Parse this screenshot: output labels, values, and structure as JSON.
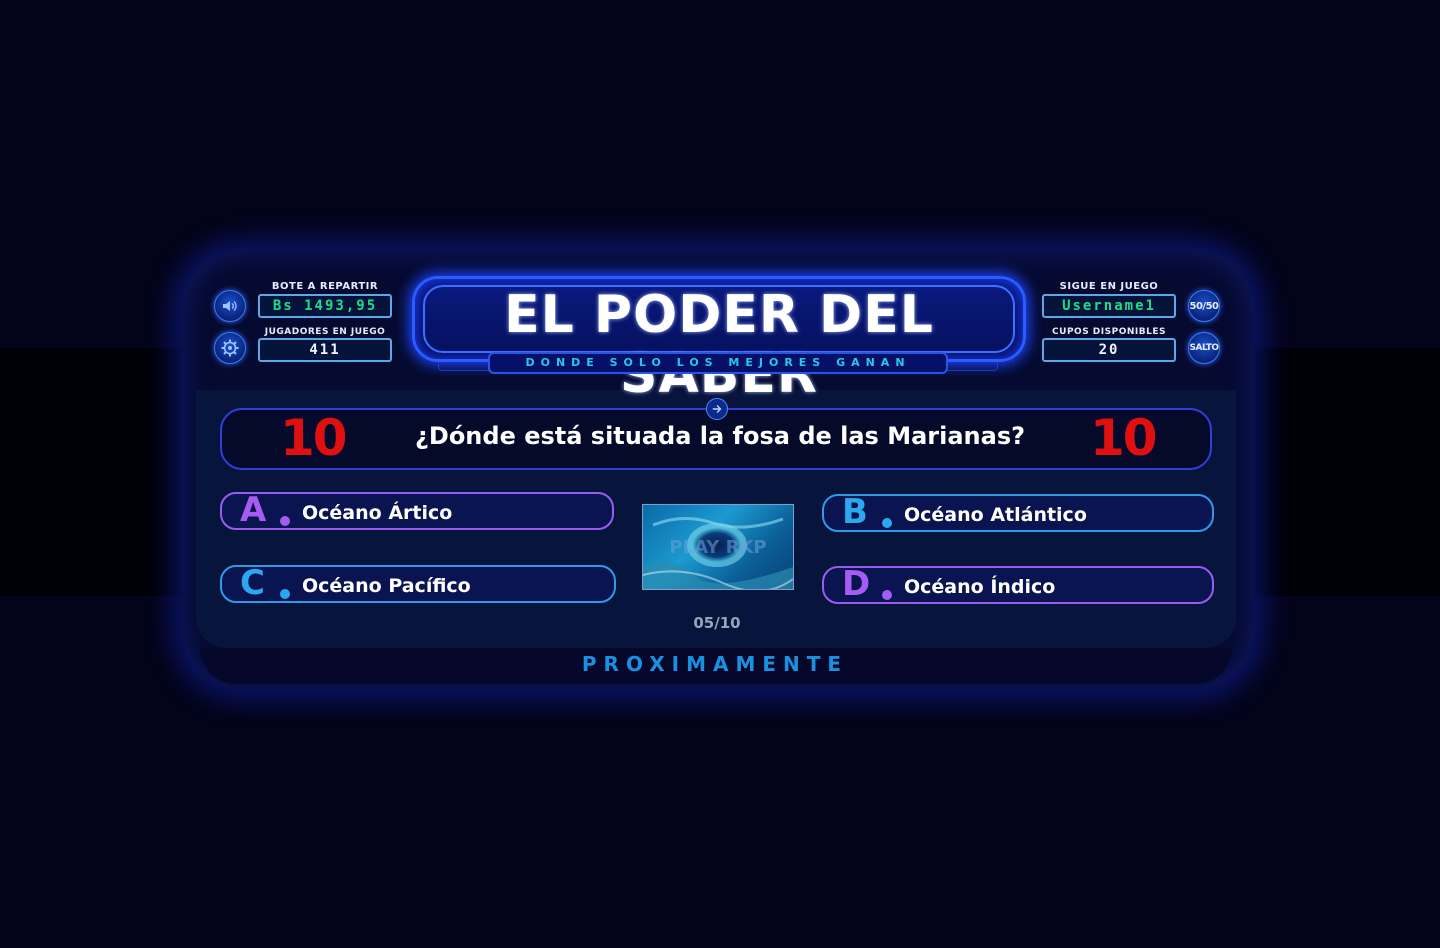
{
  "header": {
    "title": "EL PODER DEL SABER",
    "subtitle": "DONDE SOLO LOS MEJORES GANAN"
  },
  "stats_left": {
    "pot_label": "BOTE A REPARTIR",
    "pot_value": "Bs 1493,95",
    "players_label": "JUGADORES EN JUEGO",
    "players_value": "411"
  },
  "stats_right": {
    "still_playing_label": "SIGUE EN JUEGO",
    "still_playing_value": "Username1",
    "slots_label": "CUPOS DISPONIBLES",
    "slots_value": "20"
  },
  "lifelines": {
    "fifty_fifty": "50/50",
    "skip": "SALTO"
  },
  "controls": {
    "sound_icon": "speaker-icon",
    "settings_icon": "gear-icon"
  },
  "question": {
    "timer_left": "10",
    "timer_right": "10",
    "text": "¿Dónde está situada la fosa de las Marianas?",
    "image_watermark": "PLAY RKP"
  },
  "answers": [
    {
      "letter": "A",
      "text": "Océano Ártico"
    },
    {
      "letter": "B",
      "text": "Océano Atlántico"
    },
    {
      "letter": "C",
      "text": "Océano Pacífico"
    },
    {
      "letter": "D",
      "text": "Océano Índico"
    }
  ],
  "progress": {
    "counter": "05/10",
    "current": 5,
    "total": 10
  },
  "footer": {
    "label": "PROXIMAMENTE"
  },
  "colors": {
    "background": "#03041a",
    "title_border": "#2a5cff",
    "timer": "#e01010",
    "answer_purple": "#a45cf2",
    "answer_blue": "#2aa8f0",
    "pot_value": "#18e08a",
    "footer": "#1a90e0"
  }
}
